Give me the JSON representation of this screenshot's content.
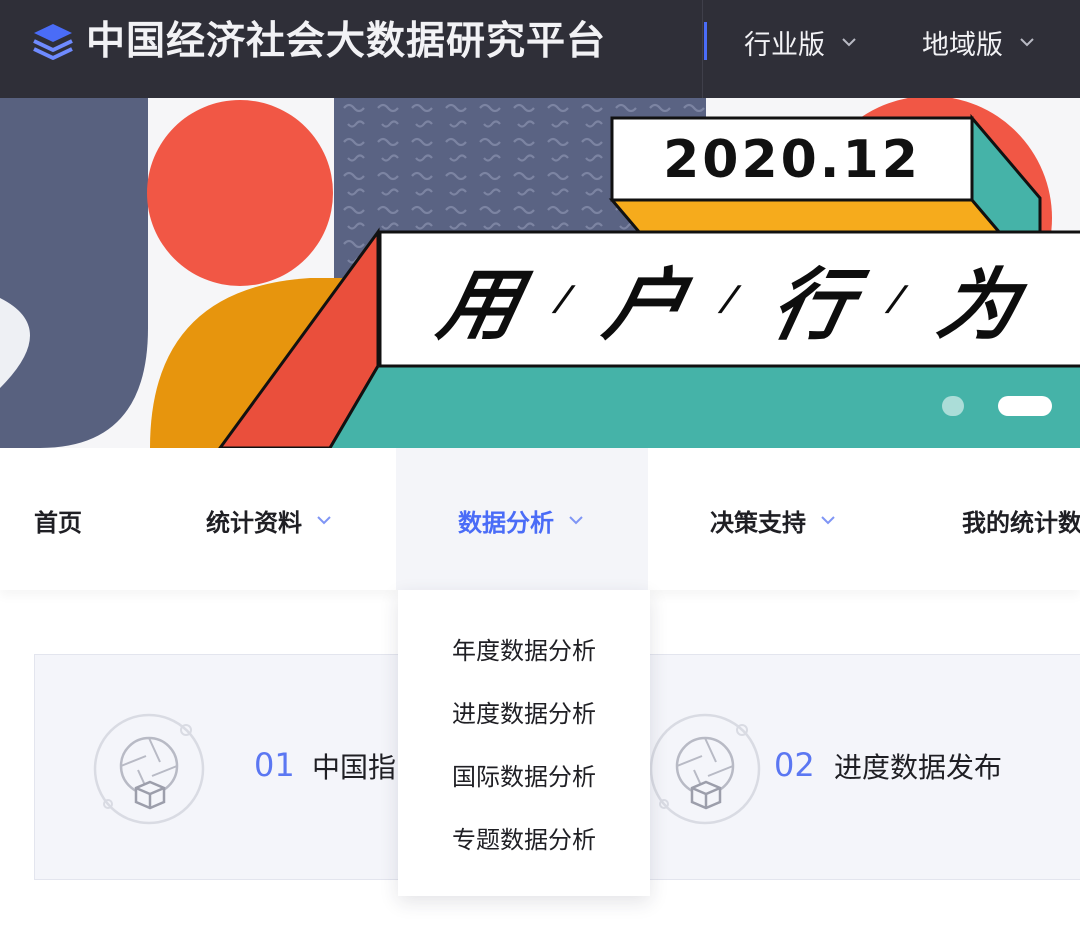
{
  "header": {
    "title": "中国经济社会大数据研究平台",
    "logo_icon": "layers-icon",
    "versions": [
      {
        "label": "行业版",
        "icon": "chevron-down-icon"
      },
      {
        "label": "地域版",
        "icon": "chevron-down-icon"
      }
    ],
    "accent_color": "#4a6cf7"
  },
  "banner": {
    "date": "2020.12",
    "headline_chars": [
      "用",
      "户",
      "行",
      "为"
    ],
    "separator": "/",
    "slides_total": 2,
    "active_slide": 2,
    "colors": {
      "navy": "#58617f",
      "red": "#f15745",
      "orange": "#e7950d",
      "teal": "#45b3a8",
      "yellow": "#f6ab1c"
    }
  },
  "nav": {
    "items": [
      {
        "label": "首页",
        "has_dropdown": false
      },
      {
        "label": "统计资料",
        "has_dropdown": true
      },
      {
        "label": "数据分析",
        "has_dropdown": true,
        "active": true
      },
      {
        "label": "决策支持",
        "has_dropdown": true
      },
      {
        "label": "我的统计数"
      }
    ],
    "dropdown": {
      "parent": "数据分析",
      "items": [
        "年度数据分析",
        "进度数据分析",
        "国际数据分析",
        "专题数据分析"
      ]
    }
  },
  "cards": [
    {
      "num": "01",
      "label": "中国指",
      "icon": "aperture-cube-icon"
    },
    {
      "num": "02",
      "label": "进度数据发布",
      "icon": "aperture-cube-icon"
    }
  ]
}
